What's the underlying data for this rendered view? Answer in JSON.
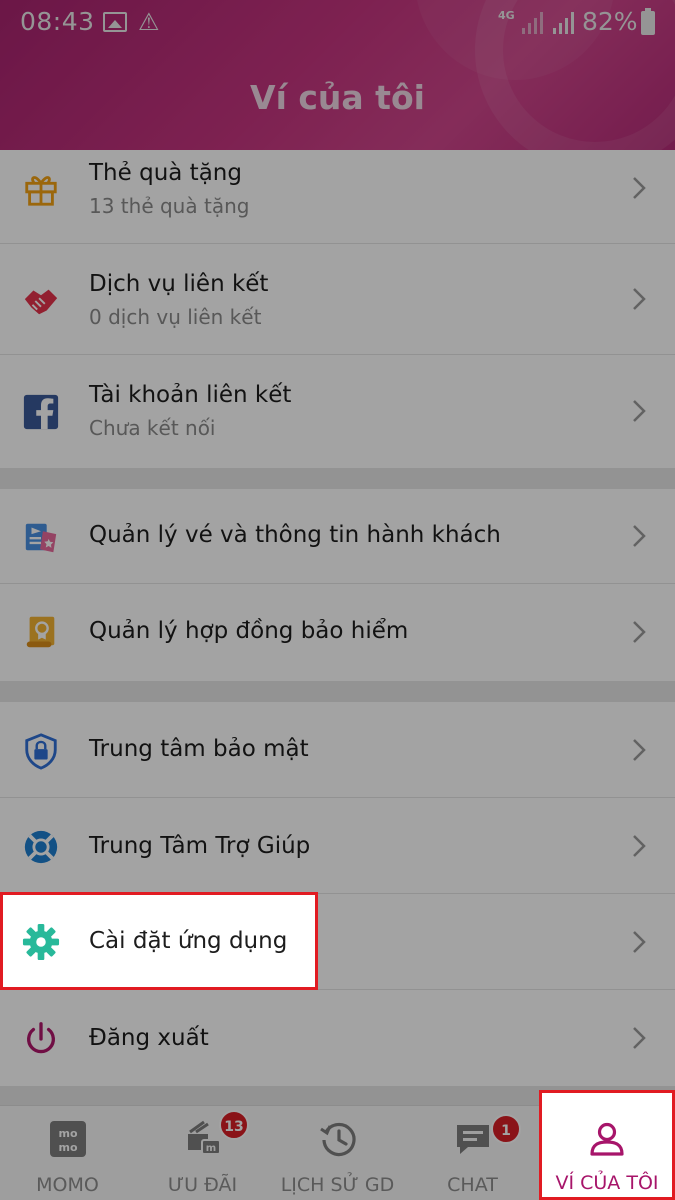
{
  "status_bar": {
    "time": "08:43",
    "network": "4G",
    "battery": "82%"
  },
  "header": {
    "title": "Ví của tôi"
  },
  "menu": {
    "group1": [
      {
        "title": "Thẻ quà tặng",
        "subtitle": "13 thẻ quà tặng",
        "icon": "gift-icon"
      },
      {
        "title": "Dịch vụ liên kết",
        "subtitle": "0 dịch vụ liên kết",
        "icon": "handshake-icon"
      },
      {
        "title": "Tài khoản liên kết",
        "subtitle": "Chưa kết nối",
        "icon": "facebook-icon"
      }
    ],
    "group2": [
      {
        "title": "Quản lý vé và thông tin hành khách",
        "icon": "ticket-icon"
      },
      {
        "title": "Quản lý hợp đồng bảo hiểm",
        "icon": "insurance-scroll-icon"
      }
    ],
    "group3": [
      {
        "title": "Trung tâm bảo mật",
        "icon": "shield-lock-icon"
      },
      {
        "title": "Trung Tâm Trợ Giúp",
        "icon": "lifebuoy-icon"
      },
      {
        "title": "Cài đặt ứng dụng",
        "icon": "gear-icon"
      },
      {
        "title": "Đăng xuất",
        "icon": "power-icon"
      }
    ]
  },
  "bottom_nav": [
    {
      "label": "MOMO",
      "icon": "momo-logo-icon"
    },
    {
      "label": "ƯU ĐÃI",
      "icon": "promo-icon",
      "badge": "13"
    },
    {
      "label": "LỊCH SỬ GD",
      "icon": "history-icon"
    },
    {
      "label": "CHAT",
      "icon": "chat-icon",
      "badge": "1"
    },
    {
      "label": "VÍ CỦA TÔI",
      "icon": "user-icon",
      "active": true
    }
  ],
  "colors": {
    "brand": "#a8246f",
    "highlight_border": "#e11b22",
    "badge": "#d81f26"
  }
}
